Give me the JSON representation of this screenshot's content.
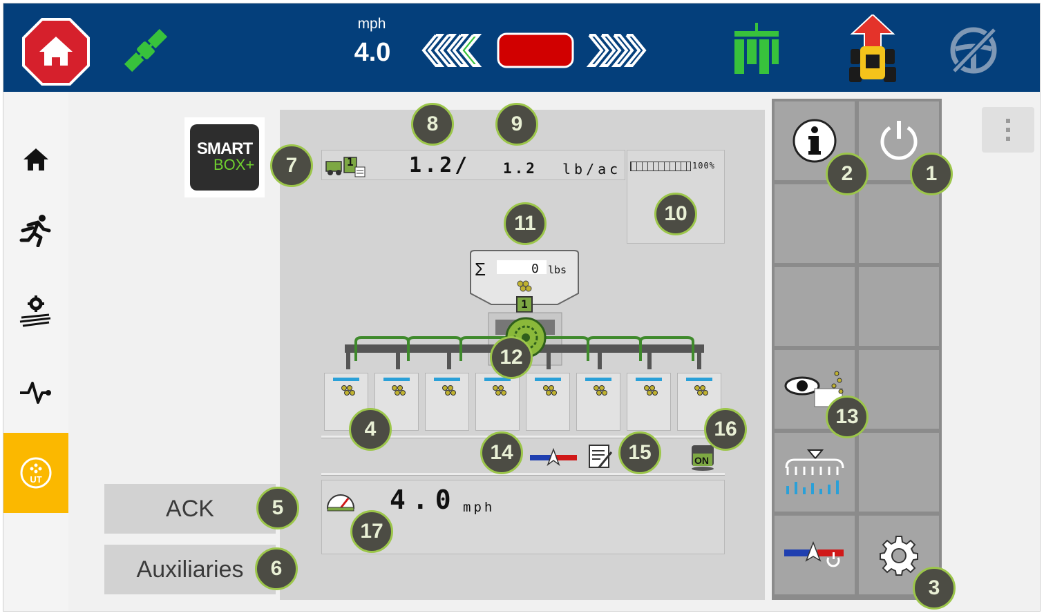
{
  "topbar": {
    "speed_unit": "mph",
    "speed_value": "4.0",
    "icons": [
      "stop-home-icon",
      "satellite-icon",
      "guidance-left-chevrons-icon",
      "guidance-offline-bar",
      "guidance-right-chevrons-icon",
      "implement-sections-icon",
      "tractor-arrow-icon",
      "steering-disabled-icon"
    ],
    "colors": {
      "bar": "#043f7b",
      "stop": "#d6202c",
      "green": "#38c23c",
      "red_bar": "#d10000"
    }
  },
  "sidebar": {
    "items": [
      {
        "icon": "home-icon",
        "active": false
      },
      {
        "icon": "run-icon",
        "active": false
      },
      {
        "icon": "field-settings-icon",
        "active": false
      },
      {
        "icon": "diagnostics-pulse-icon",
        "active": false
      },
      {
        "icon": "ut-icon",
        "label": "UT",
        "active": true
      }
    ],
    "active_color": "#fbb800"
  },
  "logo": {
    "line1": "SMART",
    "line2": "BOX+"
  },
  "buttons": {
    "ack": "ACK",
    "auxiliaries": "Auxiliaries"
  },
  "rate_bar": {
    "actual": "1.2/",
    "target": "1.2",
    "unit": "lb/ac",
    "product_number": "1"
  },
  "tank_level": {
    "percent_label": "100%",
    "percent": 1.0
  },
  "meter": {
    "sigma": "Σ",
    "total_value": "0",
    "total_unit": "lbs",
    "product_number": "1"
  },
  "rows": {
    "count": 8
  },
  "status_bar": {
    "on_label": "ON"
  },
  "speed_panel": {
    "value": "4.0",
    "unit": "mph"
  },
  "softkeys": {
    "cells": [
      {
        "icon": "info-icon"
      },
      {
        "icon": "power-icon"
      },
      {
        "icon": ""
      },
      {
        "icon": ""
      },
      {
        "icon": ""
      },
      {
        "icon": ""
      },
      {
        "icon": "monitor-seed-icon"
      },
      {
        "icon": ""
      },
      {
        "icon": "row-rate-icon"
      },
      {
        "icon": ""
      },
      {
        "icon": "rate-adjust-icon"
      },
      {
        "icon": "settings-gear-icon"
      }
    ]
  },
  "callouts": [
    "1",
    "2",
    "3",
    "4",
    "5",
    "6",
    "7",
    "8",
    "9",
    "10",
    "11",
    "12",
    "13",
    "14",
    "15",
    "16",
    "17"
  ]
}
